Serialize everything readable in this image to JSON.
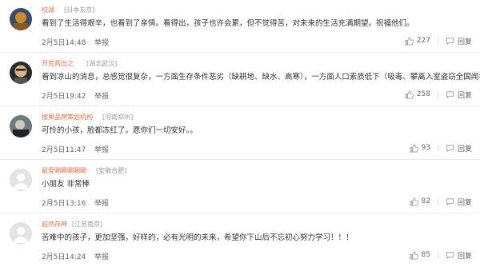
{
  "comments": [
    {
      "user": "校湖",
      "location": "[日本东京]",
      "text": "看到了生活得艰辛，也看到了亲情。看得出，孩子也许会累，但不觉得苦，对未来的生活充满期望。祝福他们。",
      "time": "2月5日14:48",
      "report": "举报",
      "likes": "227",
      "reply": "回复",
      "avatar_colors": {
        "bg": "#3d4a6a",
        "fg": "#c98a2c"
      }
    },
    {
      "user": "开荒两出之",
      "location": "[湖北武汉]",
      "text": "看到凉山的消息，总感觉很复杂，一方面生存条件恶劣（缺耕地、缺水、高寒），一方面人口素质低下（吸毒、攀离入室盗窃全国闻名）。",
      "time": "2月5日19:42",
      "report": "举报",
      "likes": "258",
      "reply": "回复",
      "avatar_colors": {
        "bg": "#2a2a2a",
        "fg": "#d7b48a"
      }
    },
    {
      "user": "搜果品牌策划机构",
      "location": "[河南郑州]",
      "text": "可怜的小孩，脸都冻红了。愿你们一切安好。。",
      "time": "2月5日11:47",
      "report": "举报",
      "likes": "93",
      "reply": "回复",
      "avatar_colors": {
        "bg": "#6d7a80",
        "fg": "#1f2428"
      }
    },
    {
      "user": "最爱唰唰唰唰唰",
      "location": "[安徽合肥]",
      "text": "小朋友 非常棒",
      "time": "2月5日13:16",
      "report": "举报",
      "likes": "82",
      "reply": "回复",
      "avatar_colors": {
        "bg": "#e3e3e3",
        "fg": "#ffffff"
      }
    },
    {
      "user": "超然存神",
      "location": "[江苏南京]",
      "text": "苦难中的孩子，更加坚强，好样的，必有光明的未来，希望你下山后不忘初心努力学习！！！",
      "time": "2月5日14:24",
      "report": "举报",
      "likes": "85",
      "reply": "回复",
      "avatar_colors": {
        "bg": "#e3e3e3",
        "fg": "#ffffff"
      }
    }
  ],
  "colors": {
    "username": "#eb7350",
    "meta": "#999999",
    "body_text": "#333333",
    "divider": "#ececec"
  },
  "icons": {
    "like": "thumbs-up-icon",
    "reply": "speech-bubble-icon"
  }
}
